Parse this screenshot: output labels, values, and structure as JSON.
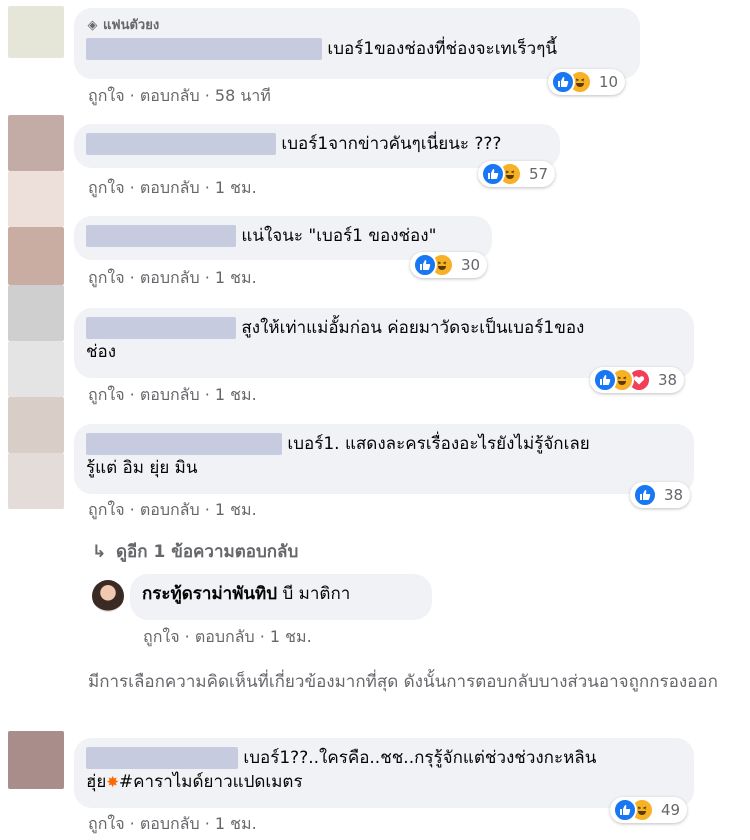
{
  "comments": [
    {
      "badge": "แฟนตัวยง",
      "text_after": "เบอร์1ของช่องที่ช่องจะเทเร็วๆนี้",
      "actions": {
        "like": "ถูกใจ",
        "reply": "ตอบกลับ",
        "time": "58 นาที"
      },
      "reactions": {
        "types": [
          "like",
          "haha"
        ],
        "count": "10"
      }
    },
    {
      "text_after": "เบอร์1จากข่าวคันๆเนี่ยนะ ???",
      "actions": {
        "like": "ถูกใจ",
        "reply": "ตอบกลับ",
        "time": "1 ชม."
      },
      "reactions": {
        "types": [
          "like",
          "haha"
        ],
        "count": "57"
      }
    },
    {
      "text_after": "แน่ใจนะ \"เบอร์1 ของช่อง\"",
      "actions": {
        "like": "ถูกใจ",
        "reply": "ตอบกลับ",
        "time": "1 ชม."
      },
      "reactions": {
        "types": [
          "like",
          "haha"
        ],
        "count": "30"
      }
    },
    {
      "text_after": "สูงให้เท่าแม่อั้มก่อน ค่อยมาวัดจะเป็นเบอร์1ของ",
      "text_line2": "ช่อง",
      "actions": {
        "like": "ถูกใจ",
        "reply": "ตอบกลับ",
        "time": "1 ชม."
      },
      "reactions": {
        "types": [
          "like",
          "haha",
          "love"
        ],
        "count": "38"
      }
    },
    {
      "text_after": "เบอร์1. แสดงละครเรื่องอะไรยังไม่รู้จักเลย",
      "text_line2": "รู้แต่ อิม ยุ่ย มิน",
      "actions": {
        "like": "ถูกใจ",
        "reply": "ตอบกลับ",
        "time": "1 ชม."
      },
      "reactions": {
        "types": [
          "like"
        ],
        "count": "38"
      }
    }
  ],
  "more_replies": "ดูอีก 1 ข้อความตอบกลับ",
  "reply": {
    "author": "กระทู้ดราม่าพันทิป",
    "text": "บี มาติกา",
    "actions": {
      "like": "ถูกใจ",
      "reply": "ตอบกลับ",
      "time": "1 ชม."
    }
  },
  "filter_note": "มีการเลือกความคิดเห็นที่เกี่ยวข้องมากที่สุด ดังนั้นการตอบกลับบางส่วนอาจถูกกรองออก",
  "last_comment": {
    "text_after": "เบอร์1??..ใครคือ..ชช..กรุรู้จักแต่ช่วงช่วงกะหลิน",
    "line2_prefix": "ฮุ่ย",
    "line2_hashtag": "#คาราไมด์ยาวแปดเมตร",
    "actions": {
      "like": "ถูกใจ",
      "reply": "ตอบกลับ",
      "time": "1 ชม."
    },
    "reactions": {
      "types": [
        "like",
        "haha"
      ],
      "count": "49"
    }
  },
  "separator": " · ",
  "colors": {
    "like": "#1877f2",
    "haha": "#f7b125",
    "love": "#f33e58",
    "bubble": "#f0f2f5",
    "meta": "#65676b"
  }
}
